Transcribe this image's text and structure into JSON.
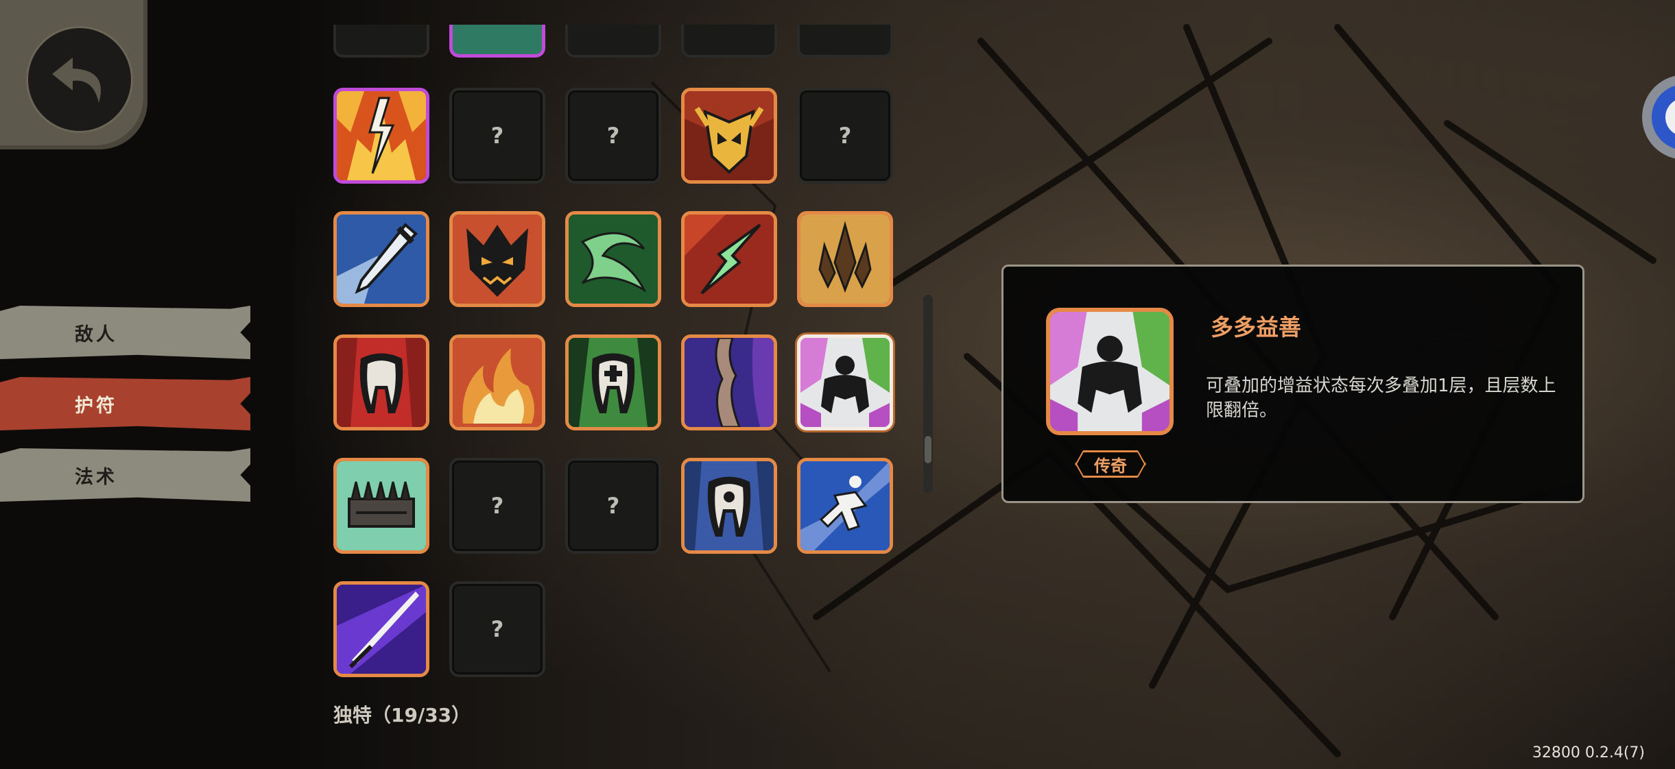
{
  "nav": {
    "back_icon": "back-arrow-icon"
  },
  "side_tabs": [
    {
      "label": "敌人",
      "active": false
    },
    {
      "label": "护符",
      "active": true
    },
    {
      "label": "法术",
      "active": false
    }
  ],
  "grid": {
    "unknown_label": "?",
    "items": [
      {
        "icon": "lightning-burst-icon",
        "frame": "purple"
      },
      {
        "icon": "unknown",
        "frame": "none"
      },
      {
        "icon": "unknown",
        "frame": "none"
      },
      {
        "icon": "golden-helmet-icon",
        "frame": "orange"
      },
      {
        "icon": "unknown",
        "frame": "none"
      },
      {
        "icon": "dagger-strike-icon",
        "frame": "orange"
      },
      {
        "icon": "demon-face-icon",
        "frame": "orange"
      },
      {
        "icon": "green-swirl-icon",
        "frame": "orange"
      },
      {
        "icon": "green-blade-icon",
        "frame": "orange"
      },
      {
        "icon": "golden-crystal-icon",
        "frame": "orange"
      },
      {
        "icon": "red-tooth-icon",
        "frame": "orange"
      },
      {
        "icon": "flame-icon",
        "frame": "orange"
      },
      {
        "icon": "healing-tooth-icon",
        "frame": "orange"
      },
      {
        "icon": "purple-rift-icon",
        "frame": "orange"
      },
      {
        "icon": "crouching-figure-icon",
        "frame": "selected"
      },
      {
        "icon": "spiked-plate-icon",
        "frame": "orange"
      },
      {
        "icon": "unknown",
        "frame": "none"
      },
      {
        "icon": "unknown",
        "frame": "none"
      },
      {
        "icon": "blue-tooth-icon",
        "frame": "orange"
      },
      {
        "icon": "running-figure-icon",
        "frame": "orange"
      },
      {
        "icon": "purple-slash-icon",
        "frame": "orange"
      },
      {
        "icon": "unknown",
        "frame": "none"
      }
    ]
  },
  "category_label": "独特（19/33）",
  "detail": {
    "title": "多多益善",
    "description": "可叠加的增益状态每次多叠加1层，且层数上限翻倍。",
    "rarity": "传奇",
    "icon": "crouching-figure-icon"
  },
  "version": "32800 0.2.4(7)",
  "colors": {
    "accent": "#e58a46",
    "active_tab": "#a8412d",
    "inactive_tab": "#8d8b7d",
    "epic": "#c04bd8"
  }
}
